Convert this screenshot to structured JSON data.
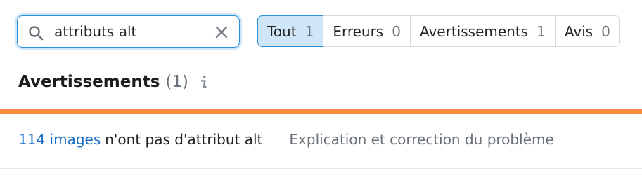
{
  "search": {
    "value": "attributs alt",
    "icon": "search-icon",
    "clear_icon": "close-icon"
  },
  "filters": [
    {
      "label": "Tout",
      "count": "1",
      "active": true
    },
    {
      "label": "Erreurs",
      "count": "0",
      "active": false
    },
    {
      "label": "Avertissements",
      "count": "1",
      "active": false
    },
    {
      "label": "Avis",
      "count": "0",
      "active": false
    }
  ],
  "section": {
    "title": "Avertissements",
    "count": "(1)",
    "info_icon": "info-icon"
  },
  "issue": {
    "link_text": "114 images",
    "text": "n'ont pas d'attribut alt",
    "help_text": "Explication et correction du problème"
  },
  "colors": {
    "accent": "#ff8c42",
    "link": "#1a6fc4",
    "active_filter_bg": "#cfe6f9",
    "focus_border": "#2a8fd8"
  }
}
